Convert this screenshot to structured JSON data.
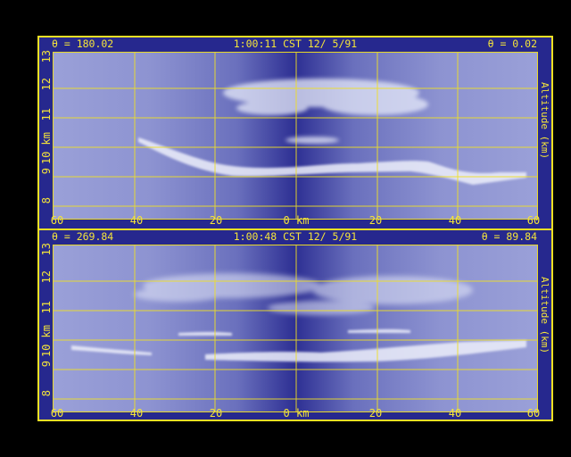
{
  "panels": [
    {
      "theta_left": "θ = 180.02",
      "timestamp": "1:00:11 CST 12/ 5/91",
      "theta_right": "θ = 0.02",
      "y_ticks": [
        "13",
        "12",
        "11",
        "10 km",
        "9",
        "8"
      ],
      "x_ticks": [
        "60",
        "40",
        "20",
        "0 km",
        "20",
        "40",
        "60"
      ],
      "right_label": "Altitude (km)"
    },
    {
      "theta_left": "θ = 269.84",
      "timestamp": "1:00:48 CST 12/ 5/91",
      "theta_right": "θ = 89.84",
      "y_ticks": [
        "13",
        "12",
        "11",
        "10 km",
        "9",
        "8"
      ],
      "x_ticks": [
        "60",
        "40",
        "20",
        "0 km",
        "20",
        "40",
        "60"
      ],
      "right_label": "Altitude (km)"
    }
  ],
  "colors": {
    "frame": "#f0e024",
    "background": "#26288e",
    "text": "#f4e43a"
  }
}
